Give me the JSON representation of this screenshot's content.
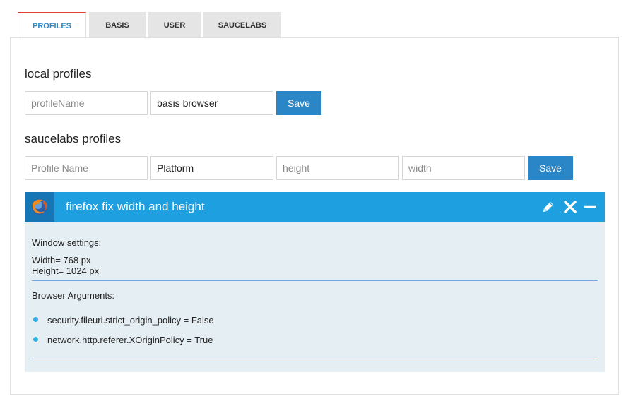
{
  "tabs": [
    {
      "label": "PROFILES",
      "active": true
    },
    {
      "label": "BASIS",
      "active": false
    },
    {
      "label": "USER",
      "active": false
    },
    {
      "label": "SAUCELABS",
      "active": false
    }
  ],
  "local": {
    "heading": "local profiles",
    "name_placeholder": "profileName",
    "browser_value": "basis browser",
    "save_label": "Save"
  },
  "saucelabs": {
    "heading": "saucelabs profiles",
    "name_placeholder": "Profile Name",
    "platform_value": "Platform",
    "height_placeholder": "height",
    "width_placeholder": "width",
    "save_label": "Save"
  },
  "profile_card": {
    "icon": "firefox-icon",
    "title": "firefox fix width and height",
    "controls": [
      "pencil-icon",
      "close-icon",
      "minimize-icon"
    ],
    "window_settings_label": "Window settings:",
    "width_line": "Width= 768 px",
    "height_line": "Height= 1024 px",
    "browser_args_label": "Browser Arguments:",
    "arguments": [
      "security.fileuri.strict_origin_policy = False",
      "network.http.referer.XOriginPolicy = True"
    ]
  },
  "colors": {
    "accent": "#2a86c7",
    "card_header": "#1d9fe0",
    "card_icon_bg": "#1676b5",
    "card_body": "#e5eef2",
    "active_tab_top": "#e0423a"
  }
}
